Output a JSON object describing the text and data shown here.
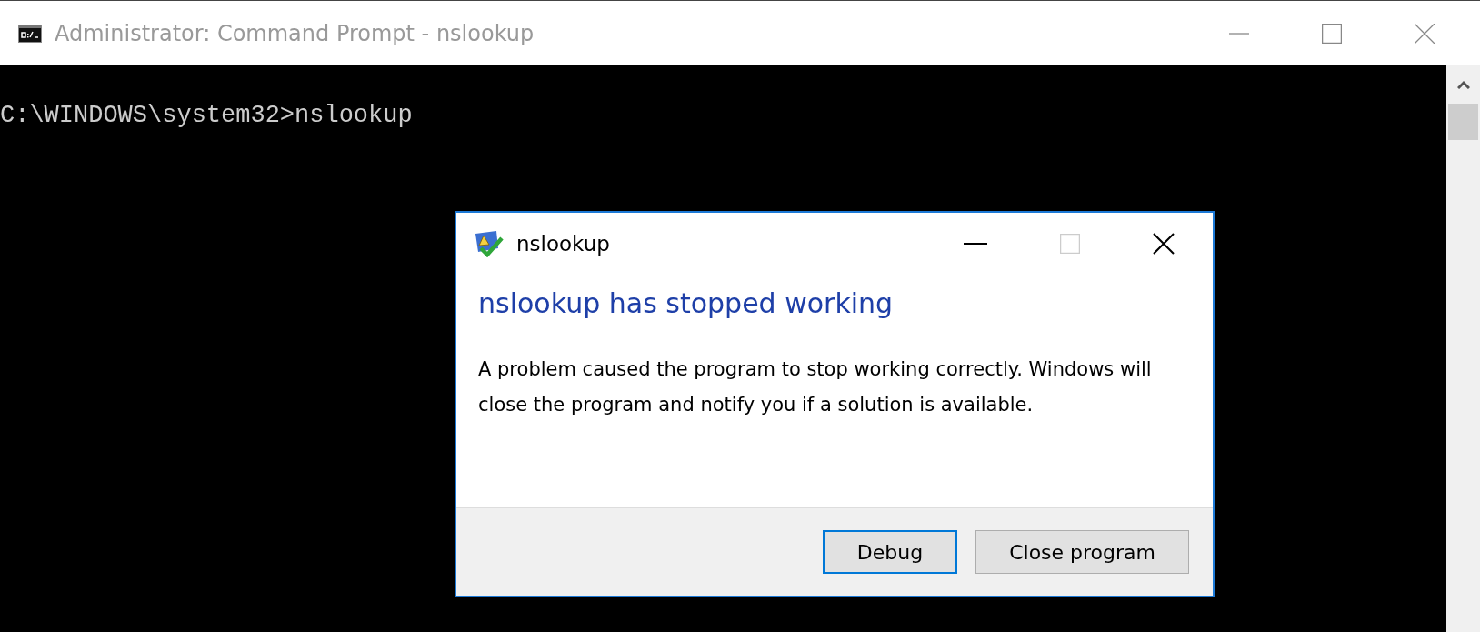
{
  "window": {
    "title": "Administrator: Command Prompt - nslookup",
    "active": false
  },
  "console": {
    "lines": [
      "C:\\WINDOWS\\system32>nslookup"
    ]
  },
  "dialog": {
    "title": "nslookup",
    "maximize_disabled": true,
    "heading": "nslookup has stopped working",
    "message": "A problem caused the program to stop working correctly. Windows will close the program and notify you if a solution is available.",
    "buttons": [
      {
        "label": "Debug",
        "default": true
      },
      {
        "label": "Close program",
        "default": false
      }
    ]
  }
}
